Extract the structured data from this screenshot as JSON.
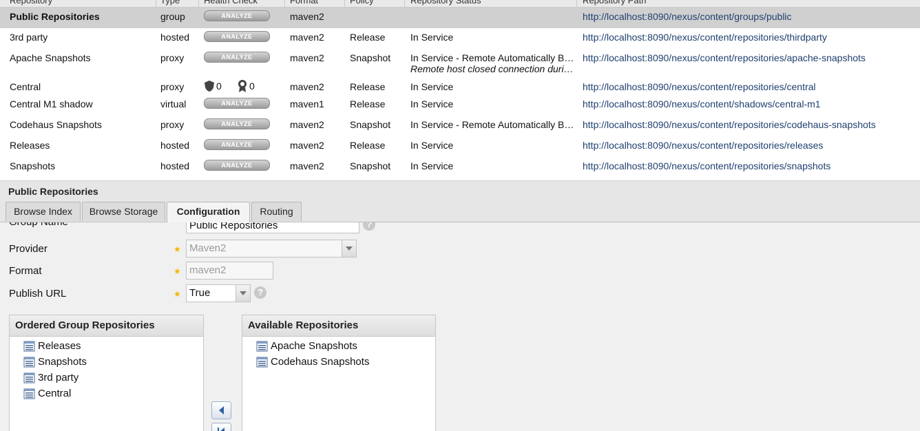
{
  "grid": {
    "headers": [
      "Repository",
      "Type",
      "Health Check",
      "Format",
      "Policy",
      "Repository Status",
      "Repository Path"
    ],
    "analyze_label": "ANALYZE",
    "rows": [
      {
        "name": "Public Repositories",
        "type": "group",
        "health": "analyze",
        "format": "maven2",
        "policy": "",
        "status": "",
        "status_detail": "",
        "path": "http://localhost:8090/nexus/content/groups/public",
        "selected": true
      },
      {
        "name": "3rd party",
        "type": "hosted",
        "health": "analyze",
        "format": "maven2",
        "policy": "Release",
        "status": "In Service",
        "status_detail": "",
        "path": "http://localhost:8090/nexus/content/repositories/thirdparty"
      },
      {
        "name": "Apache Snapshots",
        "type": "proxy",
        "health": "analyze",
        "format": "maven2",
        "policy": "Snapshot",
        "status": "In Service - Remote Automatically Blocked and Unavailable",
        "status_detail": "Remote host closed connection during handshake",
        "path": "http://localhost:8090/nexus/content/repositories/apache-snapshots"
      },
      {
        "name": "Central",
        "type": "proxy",
        "health": "badges",
        "security_count": "0",
        "license_count": "0",
        "format": "maven2",
        "policy": "Release",
        "status": "In Service",
        "status_detail": "",
        "path": "http://localhost:8090/nexus/content/repositories/central"
      },
      {
        "name": "Central M1 shadow",
        "type": "virtual",
        "health": "analyze",
        "format": "maven1",
        "policy": "Release",
        "status": "In Service",
        "status_detail": "",
        "path": "http://localhost:8090/nexus/content/shadows/central-m1"
      },
      {
        "name": "Codehaus Snapshots",
        "type": "proxy",
        "health": "analyze",
        "format": "maven2",
        "policy": "Snapshot",
        "status": "In Service - Remote Automatically Blocked and Unavailable",
        "status_detail": "",
        "path": "http://localhost:8090/nexus/content/repositories/codehaus-snapshots"
      },
      {
        "name": "Releases",
        "type": "hosted",
        "health": "analyze",
        "format": "maven2",
        "policy": "Release",
        "status": "In Service",
        "status_detail": "",
        "path": "http://localhost:8090/nexus/content/repositories/releases"
      },
      {
        "name": "Snapshots",
        "type": "hosted",
        "health": "analyze",
        "format": "maven2",
        "policy": "Snapshot",
        "status": "In Service",
        "status_detail": "",
        "path": "http://localhost:8090/nexus/content/repositories/snapshots"
      }
    ]
  },
  "panel": {
    "title": "Public Repositories",
    "tabs": [
      {
        "label": "Browse Index",
        "active": false
      },
      {
        "label": "Browse Storage",
        "active": false
      },
      {
        "label": "Configuration",
        "active": true
      },
      {
        "label": "Routing",
        "active": false
      }
    ]
  },
  "form": {
    "group_name_label": "Group Name",
    "group_name_value": "Public Repositories",
    "provider_label": "Provider",
    "provider_value": "Maven2",
    "format_label": "Format",
    "format_value": "maven2",
    "publish_url_label": "Publish URL",
    "publish_url_value": "True",
    "required_mark": "★",
    "help_mark": "?"
  },
  "ordered_group": {
    "title": "Ordered Group Repositories",
    "items": [
      "Releases",
      "Snapshots",
      "3rd party",
      "Central"
    ]
  },
  "available": {
    "title": "Available Repositories",
    "items": [
      "Apache Snapshots",
      "Codehaus Snapshots"
    ]
  },
  "colors": {
    "selected_row": "#d0d0d0",
    "link": "#1f3f6f",
    "required_star": "#f1b800"
  }
}
